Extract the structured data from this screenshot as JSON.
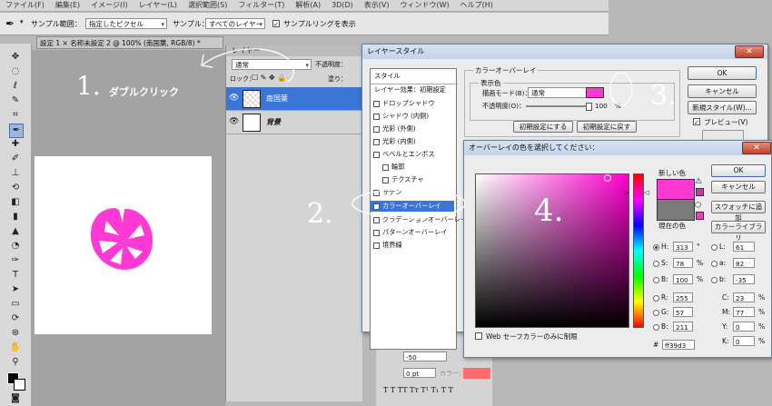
{
  "menu": {
    "items": [
      "ファイル(F)",
      "編集(E)",
      "イメージ(I)",
      "レイヤー(L)",
      "選択範囲(S)",
      "フィルター(T)",
      "解析(A)",
      "3D(D)",
      "表示(V)",
      "ウィンドウ(W)",
      "ヘルプ(H)"
    ]
  },
  "options": {
    "sample_range_label": "サンプル範囲：",
    "sample_range_value": "指定したピクセル",
    "sample_label": "サンプル：",
    "sample_value": "すべてのレイヤー",
    "show_ring_label": "サンプルリングを表示"
  },
  "doc": {
    "tab_prefix": "設定 1 ",
    "tab_title": "名称未設定 2 @ 100% (南国葉, RGB/8) *",
    "canvas_color": "#ff39d3"
  },
  "annotations": {
    "double_click": "ダブルクリック",
    "n1": "1.",
    "n2": "2.",
    "n3": "3.",
    "n4": "4."
  },
  "layers_panel": {
    "tab": "レイヤー",
    "blend_mode": "通常",
    "opacity_label": "不透明度：",
    "lock_label": "ロック：",
    "fill_label": "塗り：",
    "rows": [
      {
        "name": "南国葉",
        "selected": true
      },
      {
        "name": "背景",
        "selected": false
      }
    ]
  },
  "layer_style": {
    "title": "レイヤースタイル",
    "styles_heading": "スタイル",
    "styles_default": "レイヤー効果：初期設定",
    "items": [
      {
        "label": "ドロップシャドウ",
        "checked": false,
        "sub": false
      },
      {
        "label": "シャドウ (内側)",
        "checked": false,
        "sub": false
      },
      {
        "label": "光彩 (外側)",
        "checked": false,
        "sub": false
      },
      {
        "label": "光彩 (内側)",
        "checked": false,
        "sub": false
      },
      {
        "label": "ベベルとエンボス",
        "checked": false,
        "sub": false
      },
      {
        "label": "輪郭",
        "checked": false,
        "sub": true
      },
      {
        "label": "テクスチャ",
        "checked": false,
        "sub": true
      },
      {
        "label": "サテン",
        "checked": false,
        "sub": false
      },
      {
        "label": "カラーオーバーレイ",
        "checked": true,
        "sub": false,
        "selected": true
      },
      {
        "label": "グラデーションオーバーレイ",
        "checked": false,
        "sub": false
      },
      {
        "label": "パターンオーバーレイ",
        "checked": false,
        "sub": false
      },
      {
        "label": "境界線",
        "checked": false,
        "sub": false
      }
    ],
    "overlay_group": "カラーオーバーレイ",
    "display_color": "表示色",
    "blend_mode_label": "描画モード(B)：",
    "blend_mode_value": "通常",
    "opacity_label": "不透明度(O)：",
    "opacity_value": "100",
    "opacity_unit": "%",
    "make_default": "初期設定にする",
    "reset_default": "初期設定に戻す",
    "ok": "OK",
    "cancel": "キャンセル",
    "new_style": "新規スタイル(W)...",
    "preview": "プレビュー(V)",
    "preview_checked": true
  },
  "picker": {
    "title": "オーバーレイの色を選択してください：",
    "new_label": "新しい色",
    "current_label": "現在の色",
    "new_color": "#ff39d3",
    "current_color": "#7a7a7a",
    "ok": "OK",
    "cancel": "キャンセル",
    "add_swatch": "スウォッチに追加",
    "libraries": "カラーライブラリ",
    "web_only": "Web セーフカラーのみに制限",
    "H": {
      "label": "H:",
      "value": "313",
      "unit": "°",
      "selected": true
    },
    "S": {
      "label": "S:",
      "value": "78",
      "unit": "%"
    },
    "B": {
      "label": "B:",
      "value": "100",
      "unit": "%"
    },
    "R": {
      "label": "R:",
      "value": "255"
    },
    "G": {
      "label": "G:",
      "value": "57"
    },
    "Bb": {
      "label": "B:",
      "value": "211"
    },
    "L": {
      "label": "L:",
      "value": "61"
    },
    "a": {
      "label": "a:",
      "value": "82"
    },
    "b": {
      "label": "b:",
      "value": "-35"
    },
    "C": {
      "label": "C:",
      "value": "23",
      "unit": "%"
    },
    "M": {
      "label": "M:",
      "value": "77",
      "unit": "%"
    },
    "Y": {
      "label": "Y:",
      "value": "0",
      "unit": "%"
    },
    "K": {
      "label": "K:",
      "value": "0",
      "unit": "%"
    },
    "hex_label": "#",
    "hex_value": "ff39d3"
  },
  "char_panel": {
    "tracking": "0%",
    "baseline": "-50",
    "size": "0 pt",
    "color_label": "カラー：",
    "color": "#ff6a6a"
  }
}
